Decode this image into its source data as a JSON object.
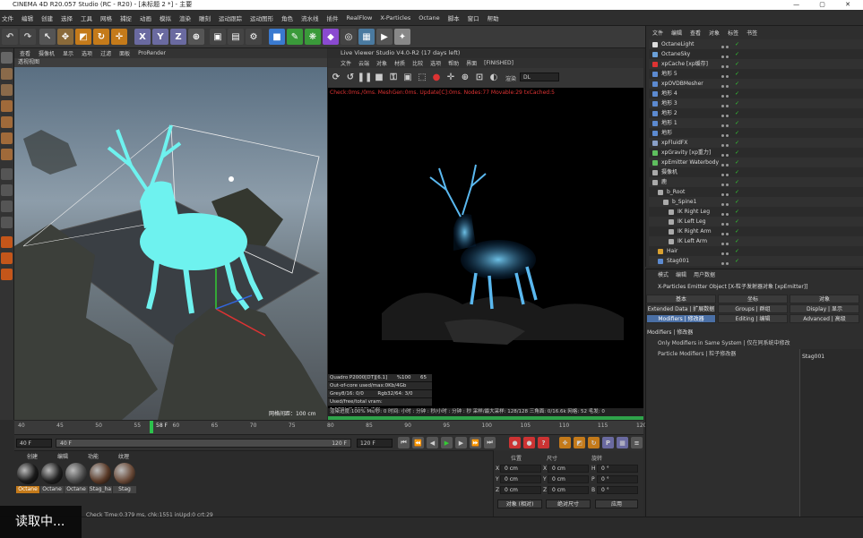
{
  "titlebar": {
    "title": "CINEMA 4D R20.057 Studio (RC - R20) - [未标题 2 *] - 主要"
  },
  "menubar": {
    "items": [
      "文件",
      "编辑",
      "创建",
      "选择",
      "工具",
      "网格",
      "捕捉",
      "动画",
      "模拟",
      "渲染",
      "雕刻",
      "运动跟踪",
      "运动图形",
      "角色",
      "流水线",
      "插件",
      "RealFlow",
      "X-Particles",
      "Octane",
      "脚本",
      "窗口",
      "帮助"
    ]
  },
  "viewport": {
    "menu": [
      "查看",
      "摄像机",
      "显示",
      "选项",
      "过滤",
      "面板",
      "ProRender"
    ],
    "label": "透视视图",
    "grid_label": "网格间距：100 cm"
  },
  "live_viewer": {
    "title": "Live Viewer Studio V4.0-R2 (17 days left)",
    "menu": [
      "文件",
      "云端",
      "对象",
      "材质",
      "比较",
      "选项",
      "帮助",
      "界面",
      "[FINISHED]"
    ],
    "preset_label": "渲染",
    "preset_value": "DL",
    "status_line": "Check:0ms./0ms. MeshGen:0ms. Update[C]:0ms. Nodes:77 Movable:29 txCached:5",
    "stats": [
      {
        "label": "Quadro P2000[DT][6.1]",
        "v1": "%100",
        "v2": "65"
      },
      {
        "label": "Out-of-core used/max:0Kb/4Gb",
        "v1": "",
        "v2": ""
      },
      {
        "label": "Grey8/16: 0/0",
        "v1": "Rgb32/64: 3/0",
        "v2": ""
      },
      {
        "label": "Used/free/total vram: 1.17Gb/2.703Gb/5Gb",
        "v1": "",
        "v2": ""
      }
    ],
    "bottom_line": "渲染进度:100%   Ms/秒: 0   时间: 小时 : 分钟 : 秒/小时 : 分钟 : 秒   采样/最大采样: 128/128   三角面: 0/16.6k   网格: 52   毛发: 0"
  },
  "timeline": {
    "ticks": [
      "40",
      "45",
      "50",
      "55",
      "60",
      "65",
      "70",
      "75",
      "80",
      "85",
      "90",
      "95",
      "100",
      "105",
      "110",
      "115",
      "120"
    ],
    "current_frame_label": "58 F",
    "start_frame": "40 F",
    "range_start": "40 F",
    "range_end": "120 F",
    "end_frame": "120 F"
  },
  "material": {
    "menu": [
      "创建",
      "编辑",
      "功能",
      "纹理"
    ],
    "items": [
      {
        "label": "Octane",
        "color": "#1a1a1a"
      },
      {
        "label": "Octane",
        "color": "#202020"
      },
      {
        "label": "Octane",
        "color": "#4a4a4a"
      },
      {
        "label": "Stag_ha",
        "color": "#5a3a28"
      },
      {
        "label": "Stag",
        "color": "#6a4a38"
      }
    ]
  },
  "coords": {
    "headers": [
      "位置",
      "尺寸",
      "旋转"
    ],
    "rows": [
      {
        "axis": "X",
        "pos": "0 cm",
        "size_axis": "X",
        "size": "0 cm",
        "rot_axis": "H",
        "rot": "0 °"
      },
      {
        "axis": "Y",
        "pos": "0 cm",
        "size_axis": "Y",
        "size": "0 cm",
        "rot_axis": "P",
        "rot": "0 °"
      },
      {
        "axis": "Z",
        "pos": "0 cm",
        "size_axis": "Z",
        "size": "0 cm",
        "rot_axis": "B",
        "rot": "0 °"
      }
    ],
    "mode_select": "对象 (相对)",
    "size_select": "绝对尺寸",
    "apply": "应用"
  },
  "status": {
    "reading": "读取中...",
    "text": "Check Time:0.379 ms, chk:1551 inUpd:0 crt:29"
  },
  "objects": {
    "tabs": [
      "文件",
      "编辑",
      "查看",
      "对象",
      "标签",
      "书签"
    ],
    "rows": [
      {
        "name": "OctaneLight",
        "indent": 0,
        "color": "#dddddd"
      },
      {
        "name": "OctaneSky",
        "indent": 0,
        "color": "#6aa0d8"
      },
      {
        "name": "xpCache [xp缓存]",
        "indent": 0,
        "color": "#d33"
      },
      {
        "name": "地形 5",
        "indent": 0,
        "color": "#5c8ad0"
      },
      {
        "name": "xpOVDBMesher",
        "indent": 0,
        "color": "#5c8ad0"
      },
      {
        "name": "地形 4",
        "indent": 0,
        "color": "#5c8ad0"
      },
      {
        "name": "地形 3",
        "indent": 0,
        "color": "#5c8ad0"
      },
      {
        "name": "地形 2",
        "indent": 0,
        "color": "#5c8ad0"
      },
      {
        "name": "地形 1",
        "indent": 0,
        "color": "#5c8ad0"
      },
      {
        "name": "地形",
        "indent": 0,
        "color": "#5c8ad0"
      },
      {
        "name": "xpFluidFX",
        "indent": 0,
        "color": "#8aa0c8"
      },
      {
        "name": "xpGravity [xp重力]",
        "indent": 0,
        "color": "#5fbf5f"
      },
      {
        "name": "xpEmitter Waterbody",
        "indent": 0,
        "color": "#5fbf5f"
      },
      {
        "name": "摄像机",
        "indent": 0,
        "color": "#aaa"
      },
      {
        "name": "鹿",
        "indent": 0,
        "color": "#aaa"
      },
      {
        "name": "b_Root",
        "indent": 1,
        "color": "#aaa"
      },
      {
        "name": "b_Spine1",
        "indent": 2,
        "color": "#aaa"
      },
      {
        "name": "IK Right Leg",
        "indent": 3,
        "color": "#aaa"
      },
      {
        "name": "IK Left Leg",
        "indent": 3,
        "color": "#aaa"
      },
      {
        "name": "IK Right Arm",
        "indent": 3,
        "color": "#aaa"
      },
      {
        "name": "IK Left Arm",
        "indent": 3,
        "color": "#aaa"
      },
      {
        "name": "Hair",
        "indent": 1,
        "color": "#d8a030"
      },
      {
        "name": "Stag001",
        "indent": 1,
        "color": "#5c8ad0"
      }
    ]
  },
  "attributes": {
    "tabs": [
      "模式",
      "编辑",
      "用户数据"
    ],
    "object_title": "X-Particles Emitter Object [X-粒子发射器对象 [xpEmitter]]",
    "tab_rows": [
      [
        "基本",
        "坐标",
        "对象"
      ],
      [
        "Extended Data | 扩展数据",
        "Groups | 群组",
        "Display | 显示"
      ],
      [
        "Modifiers | 修改器",
        "Editing | 编辑",
        "Advanced | 高级"
      ]
    ],
    "modifiers_header": "Modifiers | 修改器",
    "only_modifiers": "Only Modifiers in Same System | 仅在同系统中修改",
    "particle_modifiers": "Particle Modifiers | 粒子修改器",
    "list_item": "Stag001"
  }
}
